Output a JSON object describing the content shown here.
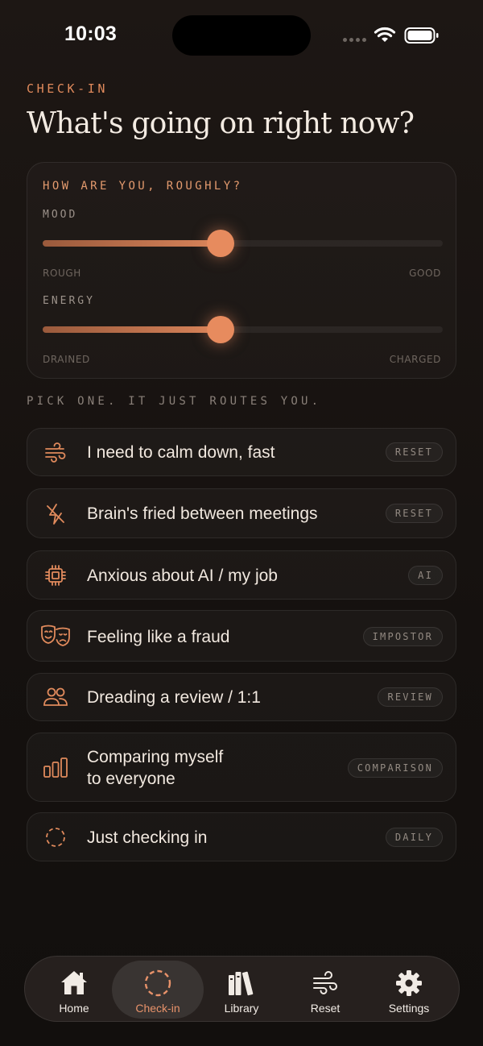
{
  "status_bar": {
    "time": "10:03"
  },
  "header": {
    "eyebrow": "CHECK-IN",
    "title": "What's going on right now?"
  },
  "mood_card": {
    "heading": "HOW ARE YOU, ROUGHLY?",
    "sliders": [
      {
        "label": "MOOD",
        "min_label": "ROUGH",
        "max_label": "GOOD",
        "value": 0.445
      },
      {
        "label": "ENERGY",
        "min_label": "DRAINED",
        "max_label": "CHARGED",
        "value": 0.445
      }
    ]
  },
  "options_caption": "PICK ONE. IT JUST ROUTES YOU.",
  "options": [
    {
      "icon": "wind-icon",
      "label": "I need to calm down, fast",
      "tag": "RESET"
    },
    {
      "icon": "zap-off-icon",
      "label": "Brain's fried between meetings",
      "tag": "RESET"
    },
    {
      "icon": "chip-icon",
      "label": "Anxious about AI / my job",
      "tag": "AI"
    },
    {
      "icon": "masks-icon",
      "label": "Feeling like a fraud",
      "tag": "IMPOSTOR"
    },
    {
      "icon": "people-icon",
      "label": "Dreading a review / 1:1",
      "tag": "REVIEW"
    },
    {
      "icon": "bars-icon",
      "label_line1": "Comparing myself",
      "label_line2": "to everyone",
      "tag": "COMPARISON"
    },
    {
      "icon": "dashed-circle-icon",
      "label": "Just checking in",
      "tag": "DAILY"
    }
  ],
  "tab_bar": {
    "tabs": [
      {
        "icon": "home-icon",
        "label": "Home",
        "active": false
      },
      {
        "icon": "dashed-circle-icon",
        "label": "Check-in",
        "active": true
      },
      {
        "icon": "library-icon",
        "label": "Library",
        "active": false
      },
      {
        "icon": "wind-icon",
        "label": "Reset",
        "active": false
      },
      {
        "icon": "gear-icon",
        "label": "Settings",
        "active": false
      }
    ]
  },
  "colors": {
    "accent": "#e78b5e",
    "background": "#15110f",
    "text": "#f1e8df"
  }
}
